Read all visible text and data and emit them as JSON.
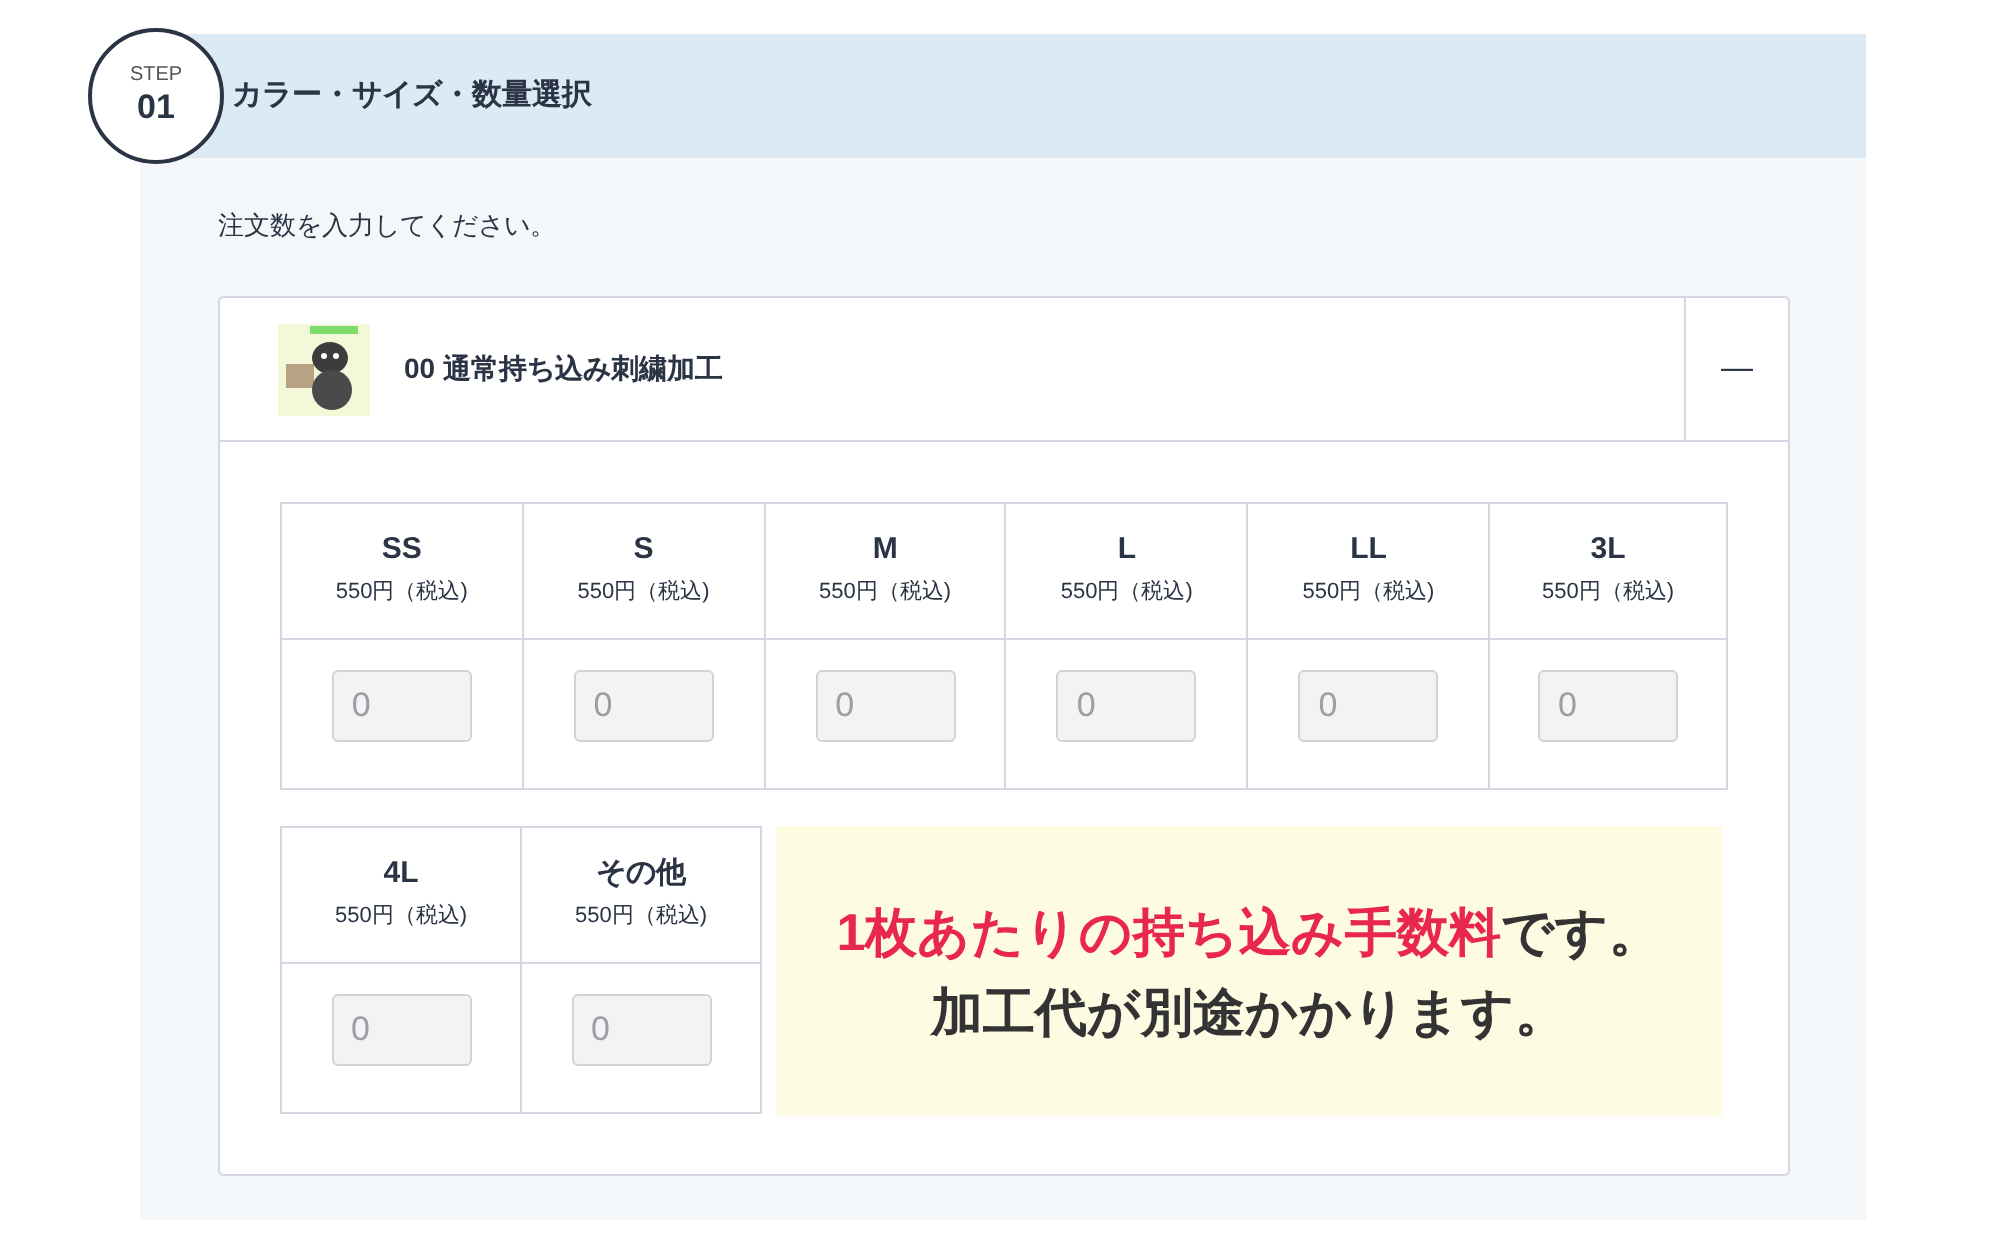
{
  "step": {
    "label": "STEP",
    "number": "01",
    "title": "カラー・サイズ・数量選択"
  },
  "instruction": "注文数を入力してください。",
  "product": {
    "name": "00 通常持ち込み刺繍加工",
    "toggle": "—",
    "sizes": [
      {
        "size": "SS",
        "price": "550円（税込)",
        "placeholder": "0"
      },
      {
        "size": "S",
        "price": "550円（税込)",
        "placeholder": "0"
      },
      {
        "size": "M",
        "price": "550円（税込)",
        "placeholder": "0"
      },
      {
        "size": "L",
        "price": "550円（税込)",
        "placeholder": "0"
      },
      {
        "size": "LL",
        "price": "550円（税込)",
        "placeholder": "0"
      },
      {
        "size": "3L",
        "price": "550円（税込)",
        "placeholder": "0"
      },
      {
        "size": "4L",
        "price": "550円（税込)",
        "placeholder": "0"
      },
      {
        "size": "その他",
        "price": "550円（税込)",
        "placeholder": "0"
      }
    ],
    "notice": [
      [
        {
          "kind": "highlight",
          "text": "1枚あたりの持ち込み手数料"
        },
        {
          "kind": "plain",
          "text": "です。"
        }
      ],
      [
        {
          "kind": "plain",
          "text": "加工代が別途かかります。"
        }
      ]
    ]
  }
}
